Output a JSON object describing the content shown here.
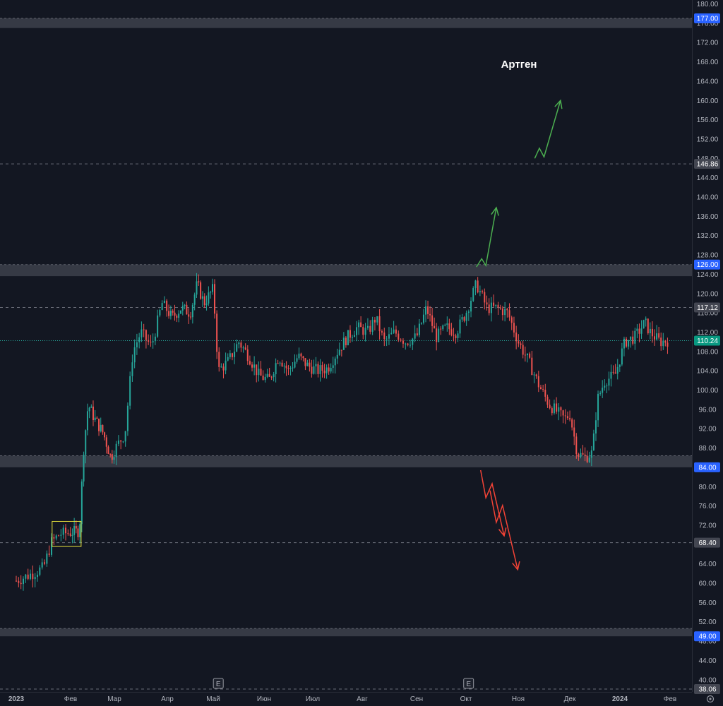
{
  "chart_data": {
    "type": "candlestick",
    "title": "Артген",
    "ylim": [
      36,
      180
    ],
    "grid": false,
    "colors": {
      "background": "#131722",
      "up": "#26a69a",
      "down": "#ef5350",
      "zone": "#363a45",
      "arrow_up": "#4caf50",
      "arrow_down": "#f44336",
      "tag_blue": "#2962ff",
      "tag_grey": "#434651",
      "tick_text": "#b2b5be"
    },
    "y_ticks": [
      "40.00",
      "44.00",
      "48.00",
      "52.00",
      "56.00",
      "60.00",
      "64.00",
      "68.00",
      "72.00",
      "76.00",
      "80.00",
      "84.00",
      "88.00",
      "92.00",
      "96.00",
      "100.00",
      "104.00",
      "108.00",
      "112.00",
      "116.00",
      "120.00",
      "124.00",
      "128.00",
      "132.00",
      "136.00",
      "140.00",
      "144.00",
      "148.00",
      "152.00",
      "156.00",
      "160.00",
      "164.00",
      "168.00",
      "172.00",
      "176.00",
      "180.00"
    ],
    "x_ticks": [
      {
        "label": "2023",
        "bold": true,
        "month": 0
      },
      {
        "label": "Фев",
        "bold": false,
        "month": 1
      },
      {
        "label": "Мар",
        "bold": false,
        "month": 2
      },
      {
        "label": "Апр",
        "bold": false,
        "month": 3
      },
      {
        "label": "Май",
        "bold": false,
        "month": 4
      },
      {
        "label": "Июн",
        "bold": false,
        "month": 5
      },
      {
        "label": "Июл",
        "bold": false,
        "month": 6
      },
      {
        "label": "Авг",
        "bold": false,
        "month": 7
      },
      {
        "label": "Сен",
        "bold": false,
        "month": 8
      },
      {
        "label": "Окт",
        "bold": false,
        "month": 9
      },
      {
        "label": "Ноя",
        "bold": false,
        "month": 10
      },
      {
        "label": "Дек",
        "bold": false,
        "month": 11
      },
      {
        "label": "2024",
        "bold": true,
        "month": 12
      },
      {
        "label": "Фев",
        "bold": false,
        "month": 13
      }
    ],
    "price_tags": [
      {
        "label": "177.00",
        "value": 177.0,
        "style": "blue"
      },
      {
        "label": "146.86",
        "value": 146.86,
        "style": "grey"
      },
      {
        "label": "126.00",
        "value": 126.0,
        "style": "blue"
      },
      {
        "label": "117.12",
        "value": 117.12,
        "style": "grey"
      },
      {
        "label": "110.24",
        "value": 110.24,
        "style": "teal"
      },
      {
        "label": "84.00",
        "value": 84.0,
        "style": "blue"
      },
      {
        "label": "68.40",
        "value": 68.4,
        "style": "grey"
      },
      {
        "label": "49.00",
        "value": 49.0,
        "style": "blue"
      },
      {
        "label": "38.06",
        "value": 38.06,
        "style": "grey"
      }
    ],
    "zones": [
      {
        "low": 175.0,
        "high": 177.0
      },
      {
        "low": 123.6,
        "high": 126.0
      },
      {
        "low": 84.0,
        "high": 86.4
      },
      {
        "low": 49.0,
        "high": 50.6
      }
    ],
    "dashed_levels": [
      146.86,
      117.12,
      68.4,
      38.06
    ],
    "current_price": 110.24,
    "earnings_markers": [
      {
        "label": "E",
        "month": 4.1
      },
      {
        "label": "E",
        "month": 9.05
      }
    ],
    "consolidation_box": {
      "month_start": 0.66,
      "month_end": 1.24,
      "low": 67.6,
      "high": 72.8
    },
    "path_keypoints": [
      [
        0.0,
        60.5
      ],
      [
        0.3,
        62.0
      ],
      [
        0.5,
        63.2
      ],
      [
        0.65,
        68.5
      ],
      [
        0.8,
        70.2
      ],
      [
        1.0,
        70.5
      ],
      [
        1.2,
        70.8
      ],
      [
        1.3,
        88.0
      ],
      [
        1.4,
        97.0
      ],
      [
        1.55,
        94.0
      ],
      [
        1.75,
        91.0
      ],
      [
        1.92,
        86.0
      ],
      [
        2.05,
        88.5
      ],
      [
        2.2,
        91.0
      ],
      [
        2.35,
        108.0
      ],
      [
        2.5,
        112.0
      ],
      [
        2.7,
        109.0
      ],
      [
        2.9,
        118.0
      ],
      [
        3.1,
        115.0
      ],
      [
        3.3,
        117.0
      ],
      [
        3.5,
        116.0
      ],
      [
        3.65,
        122.0
      ],
      [
        3.8,
        118.0
      ],
      [
        4.0,
        121.0
      ],
      [
        4.1,
        104.0
      ],
      [
        4.3,
        106.0
      ],
      [
        4.5,
        110.0
      ],
      [
        4.7,
        107.0
      ],
      [
        4.9,
        103.0
      ],
      [
        5.1,
        102.0
      ],
      [
        5.3,
        107.0
      ],
      [
        5.5,
        104.0
      ],
      [
        5.7,
        107.0
      ],
      [
        5.9,
        105.0
      ],
      [
        6.1,
        104.0
      ],
      [
        6.3,
        104.5
      ],
      [
        6.5,
        108.0
      ],
      [
        6.7,
        111.0
      ],
      [
        6.9,
        113.0
      ],
      [
        7.1,
        112.0
      ],
      [
        7.25,
        115.0
      ],
      [
        7.4,
        110.0
      ],
      [
        7.6,
        112.0
      ],
      [
        7.8,
        110.0
      ],
      [
        8.0,
        111.0
      ],
      [
        8.2,
        117.0
      ],
      [
        8.4,
        111.0
      ],
      [
        8.6,
        113.0
      ],
      [
        8.8,
        112.0
      ],
      [
        9.0,
        116.0
      ],
      [
        9.2,
        122.0
      ],
      [
        9.4,
        117.0
      ],
      [
        9.6,
        117.0
      ],
      [
        9.8,
        116.0
      ],
      [
        10.0,
        110.0
      ],
      [
        10.2,
        106.0
      ],
      [
        10.4,
        101.0
      ],
      [
        10.6,
        97.0
      ],
      [
        10.8,
        95.0
      ],
      [
        10.9,
        94.0
      ],
      [
        11.0,
        95.0
      ],
      [
        11.15,
        87.0
      ],
      [
        11.3,
        86.0
      ],
      [
        11.45,
        87.0
      ],
      [
        11.55,
        98.0
      ],
      [
        11.7,
        102.0
      ],
      [
        11.9,
        103.0
      ],
      [
        12.1,
        110.0
      ],
      [
        12.3,
        111.0
      ],
      [
        12.5,
        114.0
      ],
      [
        12.6,
        112.0
      ],
      [
        12.8,
        110.0
      ],
      [
        12.95,
        110.24
      ]
    ],
    "arrows_up": [
      [
        [
          9.2,
          125.5
        ],
        [
          9.3,
          127.2
        ],
        [
          9.38,
          125.8
        ],
        [
          9.58,
          137.8
        ]
      ],
      [
        [
          10.32,
          148.0
        ],
        [
          10.41,
          150.1
        ],
        [
          10.5,
          148.3
        ],
        [
          10.82,
          160.0
        ]
      ]
    ],
    "arrows_down": [
      [
        [
          9.28,
          83.4
        ],
        [
          9.38,
          77.7
        ],
        [
          9.5,
          80.6
        ],
        [
          9.73,
          69.8
        ]
      ],
      [
        [
          9.46,
          79.2
        ],
        [
          9.58,
          72.6
        ],
        [
          9.7,
          76.1
        ],
        [
          9.99,
          62.8
        ]
      ]
    ]
  }
}
